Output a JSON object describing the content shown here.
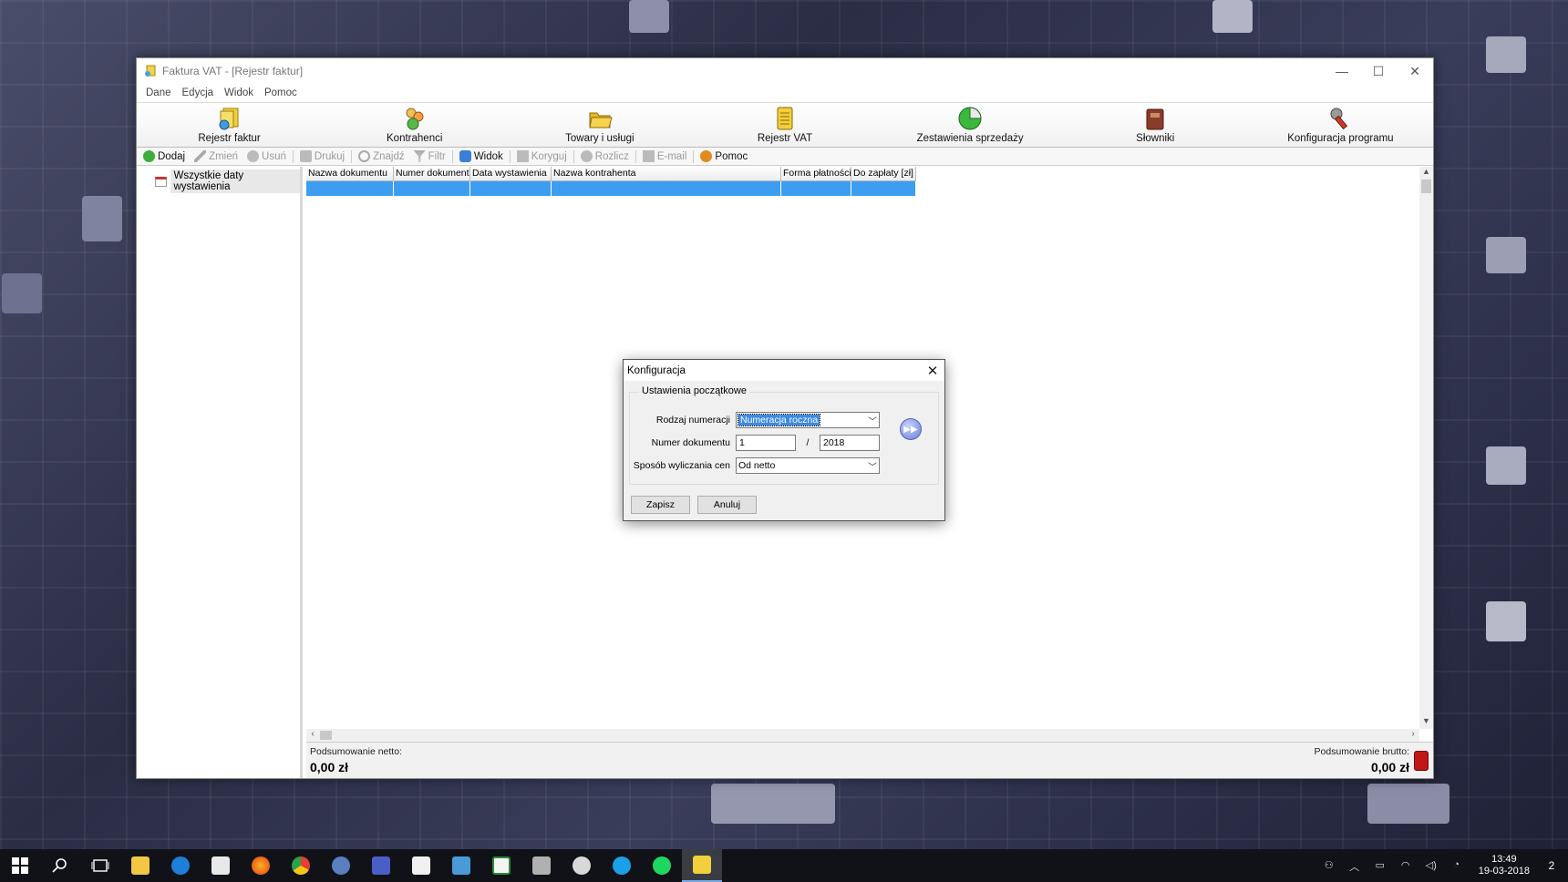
{
  "window": {
    "title": "Faktura VAT - [Rejestr faktur]",
    "minimize": "—",
    "maximize": "☐",
    "close": "✕"
  },
  "menu": [
    "Dane",
    "Edycja",
    "Widok",
    "Pomoc"
  ],
  "big_toolbar": [
    {
      "label": "Rejestr faktur",
      "icon": "invoice-register-icon"
    },
    {
      "label": "Kontrahenci",
      "icon": "contractors-icon"
    },
    {
      "label": "Towary i usługi",
      "icon": "goods-folder-icon"
    },
    {
      "label": "Rejestr VAT",
      "icon": "vat-register-icon"
    },
    {
      "label": "Zestawienia sprzedaży",
      "icon": "sales-chart-icon"
    },
    {
      "label": "Słowniki",
      "icon": "dictionary-book-icon"
    },
    {
      "label": "Konfiguracja programu",
      "icon": "configuration-tools-icon"
    }
  ],
  "small_toolbar": [
    {
      "label": "Dodaj",
      "enabled": true
    },
    {
      "label": "Zmień",
      "enabled": false
    },
    {
      "label": "Usuń",
      "enabled": false
    },
    {
      "label": "Drukuj",
      "enabled": false
    },
    {
      "label": "Znajdź",
      "enabled": false
    },
    {
      "label": "Filtr",
      "enabled": false
    },
    {
      "label": "Widok",
      "enabled": true
    },
    {
      "label": "Koryguj",
      "enabled": false
    },
    {
      "label": "Rozlicz",
      "enabled": false
    },
    {
      "label": "E-mail",
      "enabled": false
    },
    {
      "label": "Pomoc",
      "enabled": true
    }
  ],
  "tree": {
    "item": "Wszystkie daty wystawienia"
  },
  "grid": {
    "columns": [
      "Nazwa dokumentu",
      "Numer dokumentu",
      "Data wystawienia",
      "Nazwa kontrahenta",
      "Forma płatności",
      "Do zapłaty [zł]"
    ]
  },
  "summary": {
    "net_label": "Podsumowanie netto:",
    "net_value": "0,00 zł",
    "gross_label": "Podsumowanie brutto:",
    "gross_value": "0,00 zł"
  },
  "dialog": {
    "title": "Konfiguracja",
    "close": "✕",
    "group_title": "Ustawienia początkowe",
    "numbering_label": "Rodzaj numeracji",
    "numbering_value": "Numeracja roczna",
    "doc_number_label": "Numer dokumentu",
    "doc_number": "1",
    "separator": "/",
    "doc_year": "2018",
    "price_method_label": "Sposób wyliczania cen",
    "price_method_value": "Od netto",
    "save_button": "Zapisz",
    "cancel_button": "Anuluj"
  },
  "taskbar": {
    "time": "13:49",
    "date": "19-03-2018",
    "notifications": "2"
  }
}
